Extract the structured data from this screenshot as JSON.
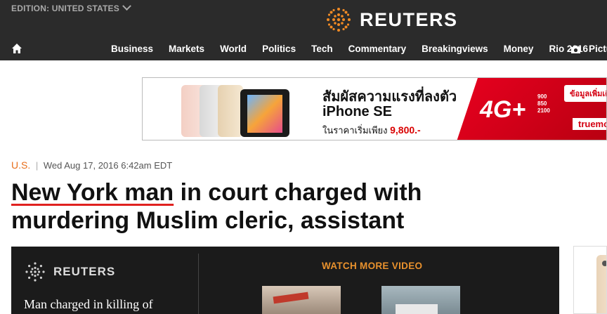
{
  "header": {
    "edition_label": "EDITION: UNITED STATES",
    "logo_text": "REUTERS",
    "nav": [
      {
        "label": "Business"
      },
      {
        "label": "Markets"
      },
      {
        "label": "World"
      },
      {
        "label": "Politics"
      },
      {
        "label": "Tech"
      },
      {
        "label": "Commentary"
      },
      {
        "label": "Breakingviews"
      },
      {
        "label": "Money"
      },
      {
        "label": "Rio 2016"
      }
    ],
    "nav_pictures": "Pictu",
    "icons": {
      "home": "home-icon",
      "camera": "camera-icon",
      "edition": "chevron-down-icon"
    }
  },
  "ad": {
    "thai_headline": "สัมผัสความแรงที่ลงตัว",
    "model": "iPhone SE",
    "price_prefix": "ในราคาเริ่มเพียง",
    "price": "9,800.-",
    "network": "4G+",
    "freqs": [
      "900",
      "850",
      "2100"
    ],
    "more_info": "ข้อมูลเพิ่มเติ",
    "brand": "truemov"
  },
  "article": {
    "section": "U.S.",
    "separator": "|",
    "date": "Wed Aug 17, 2016 6:42am EDT",
    "headline_underlined": "New York man",
    "headline_rest": " in court charged with murdering Muslim cleric, assistant"
  },
  "video": {
    "logo_text": "REUTERS",
    "caption": "Man charged in killing of",
    "watch_more": "WATCH MORE VIDEO"
  },
  "colors": {
    "topbar": "#2b2b2b",
    "logo_orange": "#f08a24",
    "section_orange": "#e86e1b",
    "underline_red": "#e0211f",
    "watch_orange": "#e8912d"
  }
}
